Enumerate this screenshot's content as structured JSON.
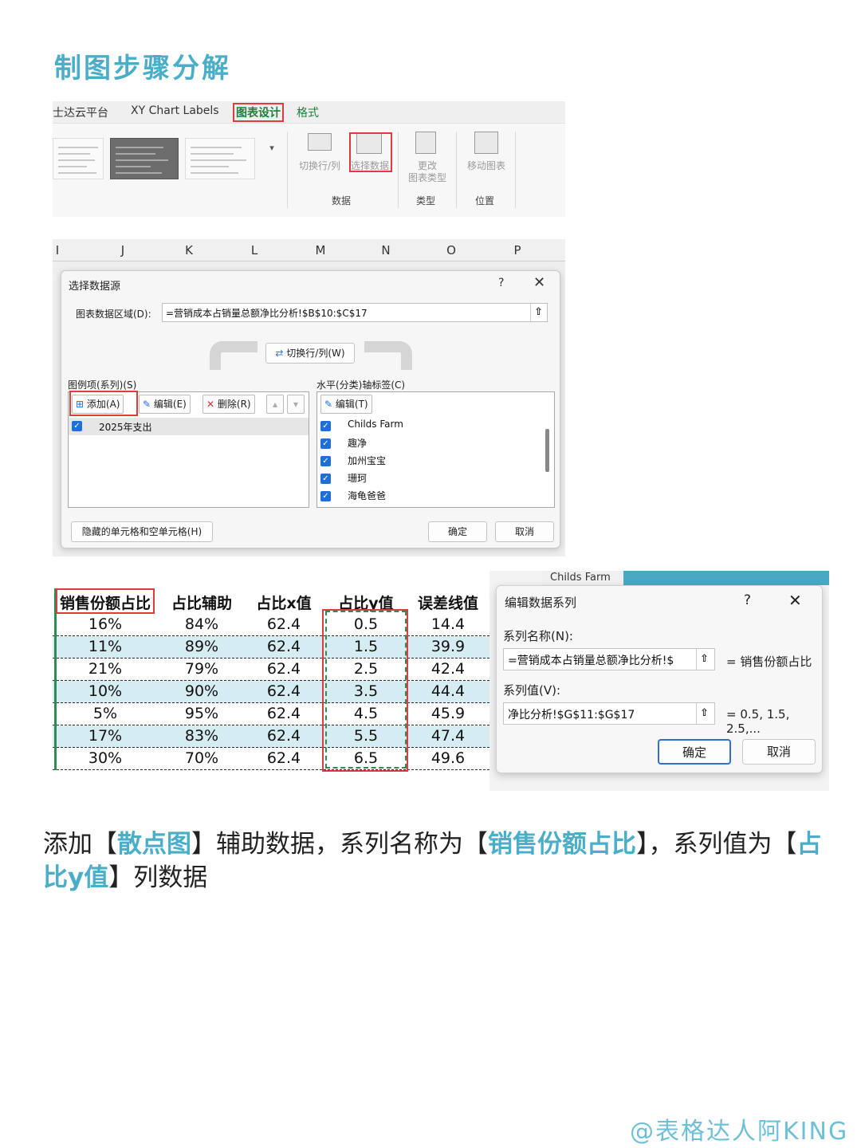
{
  "page_title": "制图步骤分解",
  "ribbon": {
    "tabs": [
      "士达云平台",
      "XY Chart Labels",
      "图表设计",
      "格式"
    ],
    "buttons": {
      "switch_row_col": "切换行/列",
      "select_data": "选择数据",
      "change_type_1": "更改",
      "change_type_2": "图表类型",
      "move_chart": "移动图表"
    },
    "groups": {
      "data": "数据",
      "type": "类型",
      "position": "位置"
    },
    "gallery_more": "▾"
  },
  "columns": [
    "I",
    "J",
    "K",
    "L",
    "M",
    "N",
    "O",
    "P"
  ],
  "dialog1": {
    "title": "选择数据源",
    "help": "?",
    "close": "✕",
    "range_label": "图表数据区域(D):",
    "range_value": "=营销成本占销量总额净比分析!$B$10:$C$17",
    "switch_button": "切换行/列(W)",
    "legend_label": "图例项(系列)(S)",
    "axis_label": "水平(分类)轴标签(C)",
    "add_button": "添加(A)",
    "edit_button": "编辑(E)",
    "delete_button": "删除(R)",
    "axis_edit_button": "编辑(T)",
    "series": [
      "2025年支出"
    ],
    "categories": [
      "Childs Farm",
      "趣净",
      "加州宝宝",
      "珊珂",
      "海龟爸爸"
    ],
    "hidden_cells_button": "隐藏的单元格和空单元格(H)",
    "ok": "确定",
    "cancel": "取消"
  },
  "table": {
    "headers": [
      "销售份额占比",
      "占比辅助",
      "占比x值",
      "占比y值",
      "误差线值"
    ],
    "rows": [
      [
        "16%",
        "84%",
        "62.4",
        "0.5",
        "14.4"
      ],
      [
        "11%",
        "89%",
        "62.4",
        "1.5",
        "39.9"
      ],
      [
        "21%",
        "79%",
        "62.4",
        "2.5",
        "42.4"
      ],
      [
        "10%",
        "90%",
        "62.4",
        "3.5",
        "44.4"
      ],
      [
        "5%",
        "95%",
        "62.4",
        "4.5",
        "45.9"
      ],
      [
        "17%",
        "83%",
        "62.4",
        "5.5",
        "47.4"
      ],
      [
        "30%",
        "70%",
        "62.4",
        "6.5",
        "49.6"
      ]
    ]
  },
  "dialog2": {
    "sheet_label": "Childs Farm",
    "title": "编辑数据系列",
    "help": "?",
    "close": "✕",
    "name_label": "系列名称(N):",
    "name_value": "=营销成本占销量总额净比分析!$",
    "name_preview": "= 销售份额占比",
    "values_label": "系列值(V):",
    "values_value": "净比分析!$G$11:$G$17",
    "values_preview": "= 0.5, 1.5, 2.5,...",
    "ok": "确定",
    "cancel": "取消"
  },
  "caption": {
    "part1": "添加【",
    "hl1": "散点图",
    "part2": "】辅助数据，系列名称为【",
    "hl2": "销售份额占比",
    "part3": "】，系列值为【",
    "hl3": "占比y值",
    "part4": "】列数据"
  },
  "signature": "@表格达人阿KING",
  "colors": {
    "accent": "#4aaec9",
    "highlight_red": "#e03c3c",
    "row_alt": "#d4ecf2",
    "excel_green": "#1e7f3a"
  }
}
